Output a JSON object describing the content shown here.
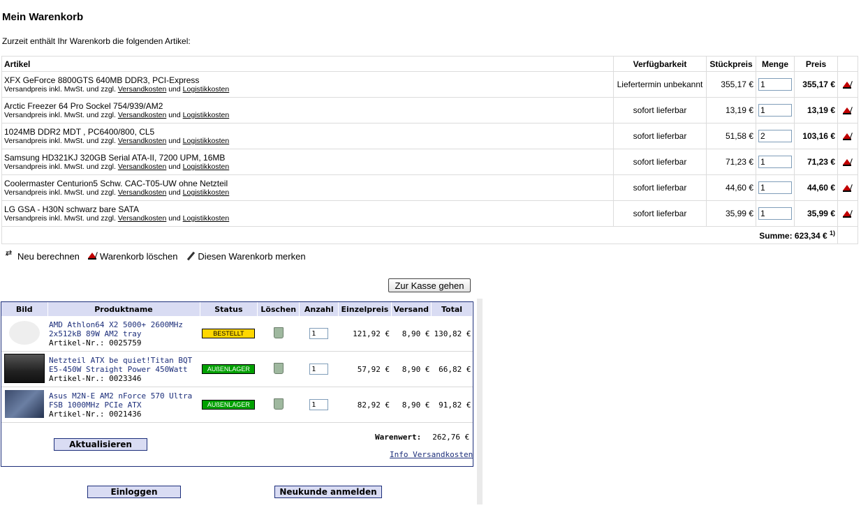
{
  "title": "Mein Warenkorb",
  "intro": "Zurzeit enthält Ihr Warenkorb die folgenden Artikel:",
  "cart": {
    "headers": {
      "artikel": "Artikel",
      "avail": "Verfügbarkeit",
      "unit": "Stückpreis",
      "qty": "Menge",
      "price": "Preis"
    },
    "sub_prefix": "Versandpreis inkl. MwSt. und zzgl.",
    "sub_link1": "Versandkosten",
    "sub_und": "und",
    "sub_link2": "Logistikkosten",
    "items": [
      {
        "name": "XFX GeForce 8800GTS 640MB DDR3, PCI-Express",
        "avail": "Liefertermin unbekannt",
        "unit": "355,17 €",
        "qty": "1",
        "price": "355,17 €"
      },
      {
        "name": "Arctic Freezer 64 Pro Sockel 754/939/AM2",
        "avail": "sofort lieferbar",
        "unit": "13,19 €",
        "qty": "1",
        "price": "13,19 €"
      },
      {
        "name": "1024MB DDR2 MDT , PC6400/800, CL5",
        "avail": "sofort lieferbar",
        "unit": "51,58 €",
        "qty": "2",
        "price": "103,16 €"
      },
      {
        "name": "Samsung HD321KJ 320GB Serial ATA-II, 7200 UPM, 16MB",
        "avail": "sofort lieferbar",
        "unit": "71,23 €",
        "qty": "1",
        "price": "71,23 €"
      },
      {
        "name": "Coolermaster Centurion5 Schw. CAC-T05-UW ohne Netzteil",
        "avail": "sofort lieferbar",
        "unit": "44,60 €",
        "qty": "1",
        "price": "44,60 €"
      },
      {
        "name": "LG GSA - H30N schwarz bare SATA",
        "avail": "sofort lieferbar",
        "unit": "35,99 €",
        "qty": "1",
        "price": "35,99 €"
      }
    ],
    "sum_label": "Summe: 623,34 €",
    "sum_note": "1)"
  },
  "actions": {
    "recalc": "Neu berechnen",
    "clear": "Warenkorb löschen",
    "save": "Diesen Warenkorb merken"
  },
  "checkout_button": "Zur Kasse gehen",
  "lower": {
    "headers": {
      "img": "Bild",
      "name": "Produktname",
      "status": "Status",
      "del": "Löschen",
      "qty": "Anzahl",
      "unit": "Einzelpreis",
      "ship": "Versand",
      "total": "Total"
    },
    "items": [
      {
        "line1": "AMD Athlon64 X2 5000+ 2600MHz",
        "line2": "2x512kB 89W AM2 tray",
        "art": "Artikel-Nr.: 0025759",
        "status": "BESTELLT",
        "qty": "1",
        "unit": "121,92 €",
        "ship": "8,90 €",
        "total": "130,82 €",
        "thumb": "no image available"
      },
      {
        "line1": "Netzteil ATX be quiet!Titan BQT",
        "line2": "E5-450W Straight Power 450Watt",
        "art": "Artikel-Nr.: 0023346",
        "status": "AUßENLAGER",
        "qty": "1",
        "unit": "57,92 €",
        "ship": "8,90 €",
        "total": "66,82 €",
        "thumb": "psu-image"
      },
      {
        "line1": "Asus M2N-E AM2 nForce 570 Ultra",
        "line2": "FSB 1000MHz PCIe ATX",
        "art": "Artikel-Nr.: 0021436",
        "status": "AUßENLAGER",
        "qty": "1",
        "unit": "82,92 €",
        "ship": "8,90 €",
        "total": "91,82 €",
        "thumb": "motherboard-image"
      }
    ],
    "update_button": "Aktualisieren",
    "warenwert_label": "Warenwert:",
    "warenwert_value": "262,76 €",
    "info_link": "Info Versandkosten"
  },
  "login_button": "Einloggen",
  "register_button": "Neukunde anmelden",
  "colors": {
    "badge_yellow": "#ffd700",
    "badge_green": "#00a000",
    "header_blue": "#d9dcf3",
    "border_blue": "#1c2e7a",
    "delete_red": "#c00000"
  }
}
